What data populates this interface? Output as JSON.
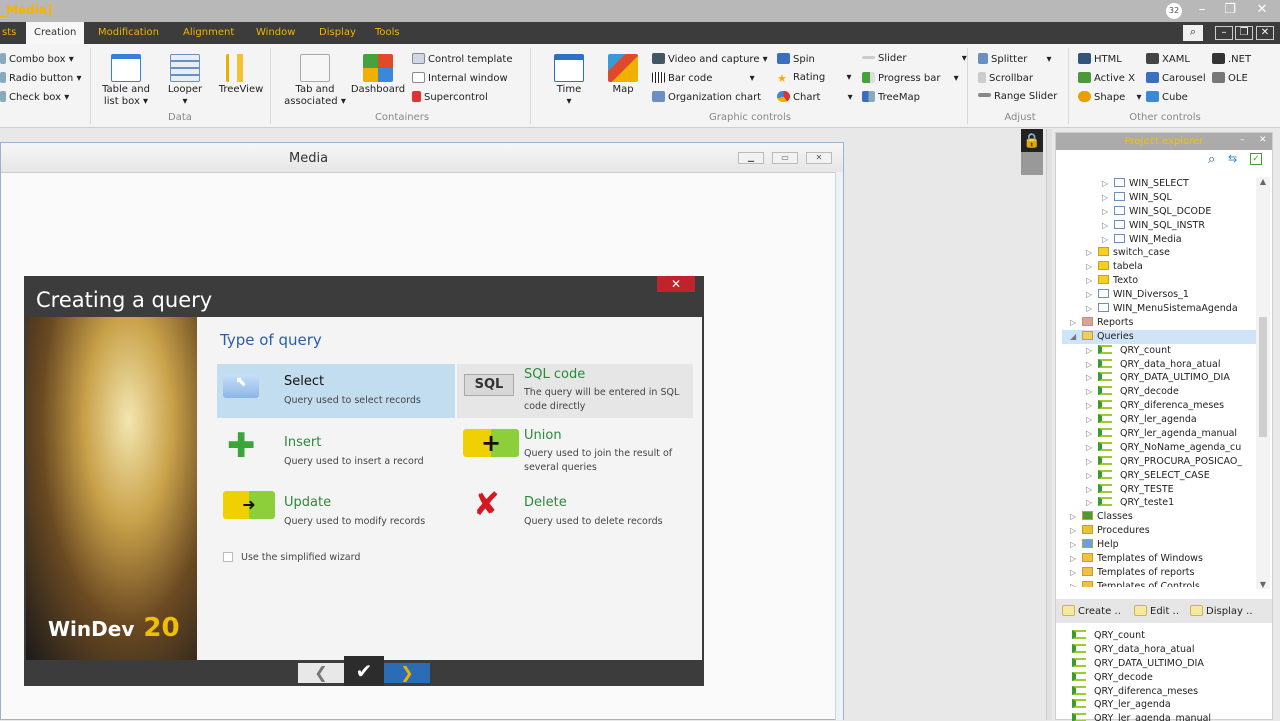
{
  "app": {
    "title": "_Media]",
    "tray_badge": "32"
  },
  "menu": {
    "tabs": [
      "sts",
      "Creation",
      "Modification",
      "Alignment",
      "Window",
      "Display",
      "Tools"
    ],
    "active": "Creation"
  },
  "ribbon": {
    "left_items": [
      "Combo box",
      "Radio button",
      "Check box"
    ],
    "data_items": [
      {
        "label": "Table and\nlist box",
        "l1": "Table and",
        "l2": "list box"
      },
      {
        "l1": "Looper",
        "l2": ""
      },
      {
        "l1": "TreeView",
        "l2": ""
      }
    ],
    "container_items": {
      "tab_l1": "Tab and",
      "tab_l2": "associated",
      "dashboard": "Dashboard",
      "control_template": "Control template",
      "internal_window": "Internal window",
      "supercontrol": "Supercontrol"
    },
    "graphic_items": {
      "time": "Time",
      "map": "Map",
      "video": "Video and capture",
      "barcode": "Bar code",
      "orgchart": "Organization chart",
      "spin": "Spin",
      "rating": "Rating",
      "chart": "Chart",
      "slider": "Slider",
      "progress": "Progress bar",
      "treemap": "TreeMap"
    },
    "adjust_items": {
      "splitter": "Splitter",
      "scrollbar": "Scrollbar",
      "range": "Range Slider"
    },
    "other_items": {
      "html": "HTML",
      "activex": "Active X",
      "shape": "Shape",
      "xaml": "XAML",
      "carousel": "Carousel",
      "cube": "Cube",
      "net": ".NET",
      "ole": "OLE"
    },
    "groups": {
      "data": "Data",
      "containers": "Containers",
      "graphic": "Graphic controls",
      "adjust": "Adjust",
      "other": "Other controls"
    }
  },
  "form": {
    "title": "Media"
  },
  "dialog": {
    "title": "Creating a query",
    "close": "✕",
    "heading": "Type of query",
    "options": [
      {
        "title": "Select",
        "desc": "Query used to select records"
      },
      {
        "title": "SQL code",
        "desc1": "The query will be entered in SQL",
        "desc2": "code directly"
      },
      {
        "title": "Insert",
        "desc": "Query used to insert a record"
      },
      {
        "title": "Union",
        "desc1": "Query used to join the result of",
        "desc2": "several queries"
      },
      {
        "title": "Update",
        "desc": "Query used to modify records"
      },
      {
        "title": "Delete",
        "desc": "Query used to delete records"
      }
    ],
    "simplified": "Use the simplified wizard",
    "logo": "WINDEV 20",
    "sql_icon": "SQL"
  },
  "explorer": {
    "title": "Project explorer",
    "tree": [
      {
        "t": "WIN_SELECT",
        "lvl": 3,
        "k": "win"
      },
      {
        "t": "WIN_SQL",
        "lvl": 3,
        "k": "win"
      },
      {
        "t": "WIN_SQL_DCODE",
        "lvl": 3,
        "k": "win"
      },
      {
        "t": "WIN_SQL_INSTR",
        "lvl": 3,
        "k": "win"
      },
      {
        "t": "WIN_Media",
        "lvl": 3,
        "k": "win"
      },
      {
        "t": "switch_case",
        "lvl": 2,
        "k": "folder"
      },
      {
        "t": "tabela",
        "lvl": 2,
        "k": "folder"
      },
      {
        "t": "Texto",
        "lvl": 2,
        "k": "folder"
      },
      {
        "t": "WIN_Diversos_1",
        "lvl": 2,
        "k": "win"
      },
      {
        "t": "WIN_MenuSistemaAgenda",
        "lvl": 2,
        "k": "win"
      },
      {
        "t": "Reports",
        "lvl": 1,
        "k": "rep"
      },
      {
        "t": "Queries",
        "lvl": 1,
        "k": "qry",
        "sel": true
      },
      {
        "t": "QRY_count",
        "lvl": 2,
        "k": "q"
      },
      {
        "t": "QRY_data_hora_atual",
        "lvl": 2,
        "k": "q"
      },
      {
        "t": "QRY_DATA_ULTIMO_DIA",
        "lvl": 2,
        "k": "q"
      },
      {
        "t": "QRY_decode",
        "lvl": 2,
        "k": "q"
      },
      {
        "t": "QRY_diferenca_meses",
        "lvl": 2,
        "k": "q"
      },
      {
        "t": "QRY_ler_agenda",
        "lvl": 2,
        "k": "q"
      },
      {
        "t": "QRY_ler_agenda_manual",
        "lvl": 2,
        "k": "q"
      },
      {
        "t": "QRY_NoName_agenda_cu",
        "lvl": 2,
        "k": "q"
      },
      {
        "t": "QRY_PROCURA_POSICAO_",
        "lvl": 2,
        "k": "q"
      },
      {
        "t": "QRY_SELECT_CASE",
        "lvl": 2,
        "k": "q"
      },
      {
        "t": "QRY_TESTE",
        "lvl": 2,
        "k": "q"
      },
      {
        "t": "QRY_teste1",
        "lvl": 2,
        "k": "q"
      },
      {
        "t": "Classes",
        "lvl": 1,
        "k": "cls"
      },
      {
        "t": "Procedures",
        "lvl": 1,
        "k": "proc"
      },
      {
        "t": "Help",
        "lvl": 1,
        "k": "help"
      },
      {
        "t": "Templates of Windows",
        "lvl": 1,
        "k": "tpl"
      },
      {
        "t": "Templates of reports",
        "lvl": 1,
        "k": "tpl"
      },
      {
        "t": "Templates of Controls",
        "lvl": 1,
        "k": "tpl"
      }
    ],
    "actions": [
      "Create",
      "Edit",
      "Display"
    ],
    "list": [
      "QRY_count",
      "QRY_data_hora_atual",
      "QRY_DATA_ULTIMO_DIA",
      "QRY_decode",
      "QRY_diferenca_meses",
      "QRY_ler_agenda",
      "QRY_ler_agenda_manual"
    ]
  }
}
